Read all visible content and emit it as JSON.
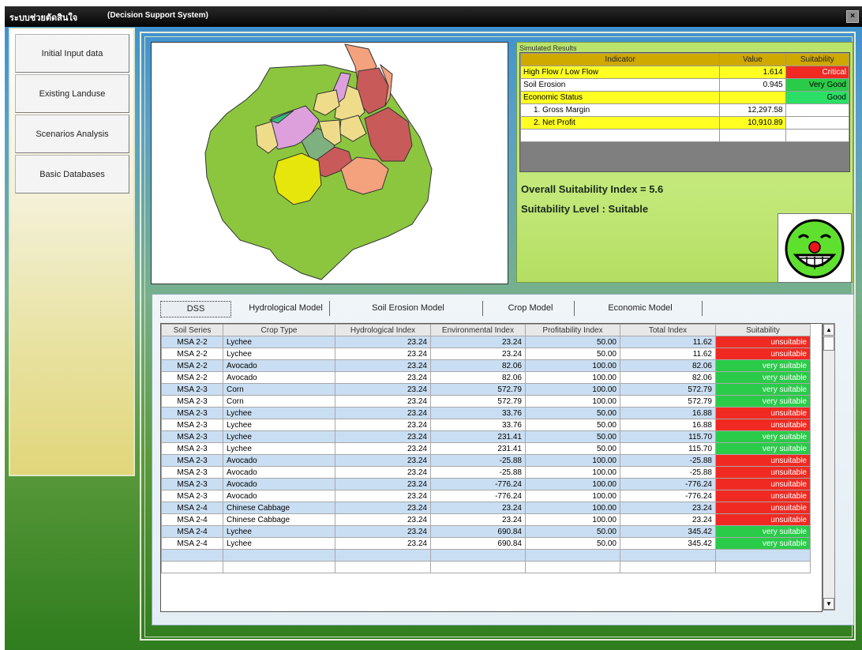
{
  "window": {
    "title_thai": "ระบบช่วยตัดสินใจ",
    "title_en": "(Decision Support System)",
    "close_label": "×"
  },
  "sidebar": {
    "items": [
      {
        "label": "Initial Input data"
      },
      {
        "label": "Existing Landuse"
      },
      {
        "label": "Scenarios Analysis"
      },
      {
        "label": "Basic Databases"
      }
    ]
  },
  "results": {
    "section_label": "Simulated Results",
    "columns": [
      "Indicator",
      "Value",
      "Suitability"
    ],
    "rows": [
      {
        "indicator": "High Flow / Low Flow",
        "value": "1.614",
        "suitability": "Critical"
      },
      {
        "indicator": "Soil Erosion",
        "value": "0.945",
        "suitability": "Very Good"
      },
      {
        "indicator": "Economic Status",
        "value": "",
        "suitability": "Good"
      },
      {
        "indicator": "1. Gross Margin",
        "value": "12,297.58",
        "suitability": ""
      },
      {
        "indicator": "2. Net Profit",
        "value": "10,910.89",
        "suitability": ""
      }
    ],
    "colors": {
      "critical": "#f02a22",
      "very_good": "#2bcb4a",
      "good": "#2bdf66",
      "highlight": "#ffff22",
      "header": "#cfa800"
    },
    "overall": "Overall Suitability Index = 5.6",
    "level": "Suitability Level : Suitable",
    "face_icon": "laughing-face-icon"
  },
  "tabs": [
    {
      "label": "DSS",
      "active": true
    },
    {
      "label": "Hydrological Model",
      "active": false
    },
    {
      "label": "Soil Erosion Model",
      "active": false
    },
    {
      "label": "Crop Model",
      "active": false
    },
    {
      "label": "Economic Model",
      "active": false
    }
  ],
  "grid": {
    "columns": [
      "Soil Series",
      "Crop Type",
      "Hydrological Index",
      "Environmental Index",
      "Profitability Index",
      "Total Index",
      "Suitability"
    ],
    "rows": [
      [
        "MSA 2-2",
        "Lychee",
        "23.24",
        "23.24",
        "50.00",
        "11.62",
        "unsuitable"
      ],
      [
        "MSA 2-2",
        "Lychee",
        "23.24",
        "23.24",
        "50.00",
        "11.62",
        "unsuitable"
      ],
      [
        "MSA 2-2",
        "Avocado",
        "23.24",
        "82.06",
        "100.00",
        "82.06",
        "very suitable"
      ],
      [
        "MSA 2-2",
        "Avocado",
        "23.24",
        "82.06",
        "100.00",
        "82.06",
        "very suitable"
      ],
      [
        "MSA 2-3",
        "Corn",
        "23.24",
        "572.79",
        "100.00",
        "572.79",
        "very suitable"
      ],
      [
        "MSA 2-3",
        "Corn",
        "23.24",
        "572.79",
        "100.00",
        "572.79",
        "very suitable"
      ],
      [
        "MSA 2-3",
        "Lychee",
        "23.24",
        "33.76",
        "50.00",
        "16.88",
        "unsuitable"
      ],
      [
        "MSA 2-3",
        "Lychee",
        "23.24",
        "33.76",
        "50.00",
        "16.88",
        "unsuitable"
      ],
      [
        "MSA 2-3",
        "Lychee",
        "23.24",
        "231.41",
        "50.00",
        "115.70",
        "very suitable"
      ],
      [
        "MSA 2-3",
        "Lychee",
        "23.24",
        "231.41",
        "50.00",
        "115.70",
        "very suitable"
      ],
      [
        "MSA 2-3",
        "Avocado",
        "23.24",
        "-25.88",
        "100.00",
        "-25.88",
        "unsuitable"
      ],
      [
        "MSA 2-3",
        "Avocado",
        "23.24",
        "-25.88",
        "100.00",
        "-25.88",
        "unsuitable"
      ],
      [
        "MSA 2-3",
        "Avocado",
        "23.24",
        "-776.24",
        "100.00",
        "-776.24",
        "unsuitable"
      ],
      [
        "MSA 2-3",
        "Avocado",
        "23.24",
        "-776.24",
        "100.00",
        "-776.24",
        "unsuitable"
      ],
      [
        "MSA 2-4",
        "Chinese Cabbage",
        "23.24",
        "23.24",
        "100.00",
        "23.24",
        "unsuitable"
      ],
      [
        "MSA 2-4",
        "Chinese Cabbage",
        "23.24",
        "23.24",
        "100.00",
        "23.24",
        "unsuitable"
      ],
      [
        "MSA 2-4",
        "Lychee",
        "23.24",
        "690.84",
        "50.00",
        "345.42",
        "very suitable"
      ],
      [
        "MSA 2-4",
        "Lychee",
        "23.24",
        "690.84",
        "50.00",
        "345.42",
        "very suitable"
      ],
      [
        "",
        "",
        "",
        "",
        "",
        "",
        ""
      ],
      [
        "",
        "",
        "",
        "",
        "",
        "",
        ""
      ]
    ],
    "colors": {
      "unsuitable": "#f02a22",
      "very suitable": "#2bcb4a",
      "alt_row": "#c9def2"
    }
  },
  "map": {
    "polygon_colors": [
      "#8cc63f",
      "#f4a17e",
      "#c85a5a",
      "#dda0dd",
      "#eedc8a",
      "#e6e60c",
      "#7fb07f",
      "#2ec07a"
    ]
  }
}
